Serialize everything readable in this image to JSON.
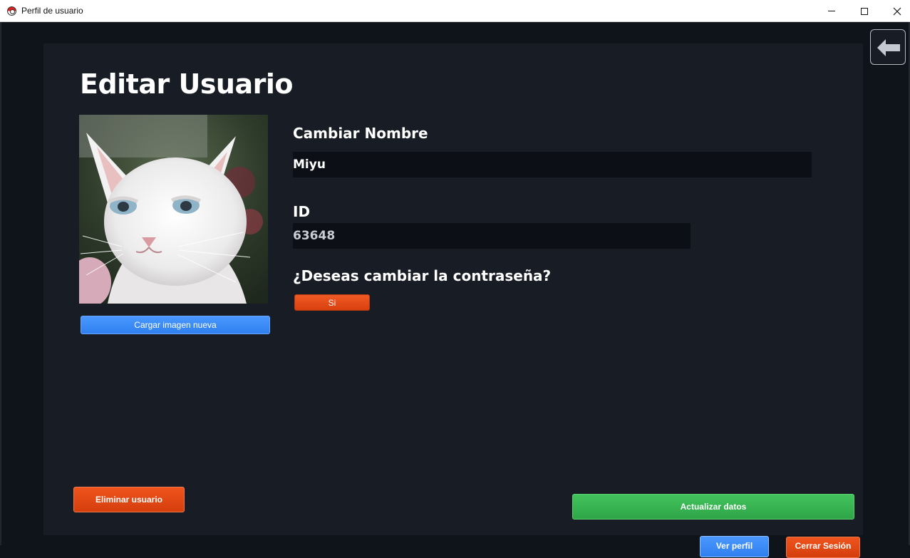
{
  "window": {
    "title": "Perfil de usuario",
    "icon": "pokeball-icon",
    "controls": [
      "minimize-icon",
      "maximize-icon",
      "close-icon"
    ]
  },
  "header": {
    "title": "Editar Usuario",
    "back_icon": "arrow-left-icon"
  },
  "avatar": {
    "description_icon": "profile-photo",
    "upload_label": "Cargar imagen nueva"
  },
  "form": {
    "name_label": "Cambiar Nombre",
    "name_value": "Miyu",
    "id_label": "ID",
    "id_value": "63648",
    "password_question": "¿Deseas cambiar la contraseña?",
    "password_yes_label": "Si"
  },
  "actions": {
    "delete_label": "Eliminar usuario",
    "update_label": "Actualizar datos",
    "view_profile_label": "Ver perfil",
    "logout_label": "Cerrar Sesión"
  },
  "colors": {
    "background": "#0f131a",
    "panel": "#181c24",
    "field": "#0c1016",
    "blue": "#3b8bfa",
    "orange": "#e04a14",
    "green": "#38b552"
  }
}
